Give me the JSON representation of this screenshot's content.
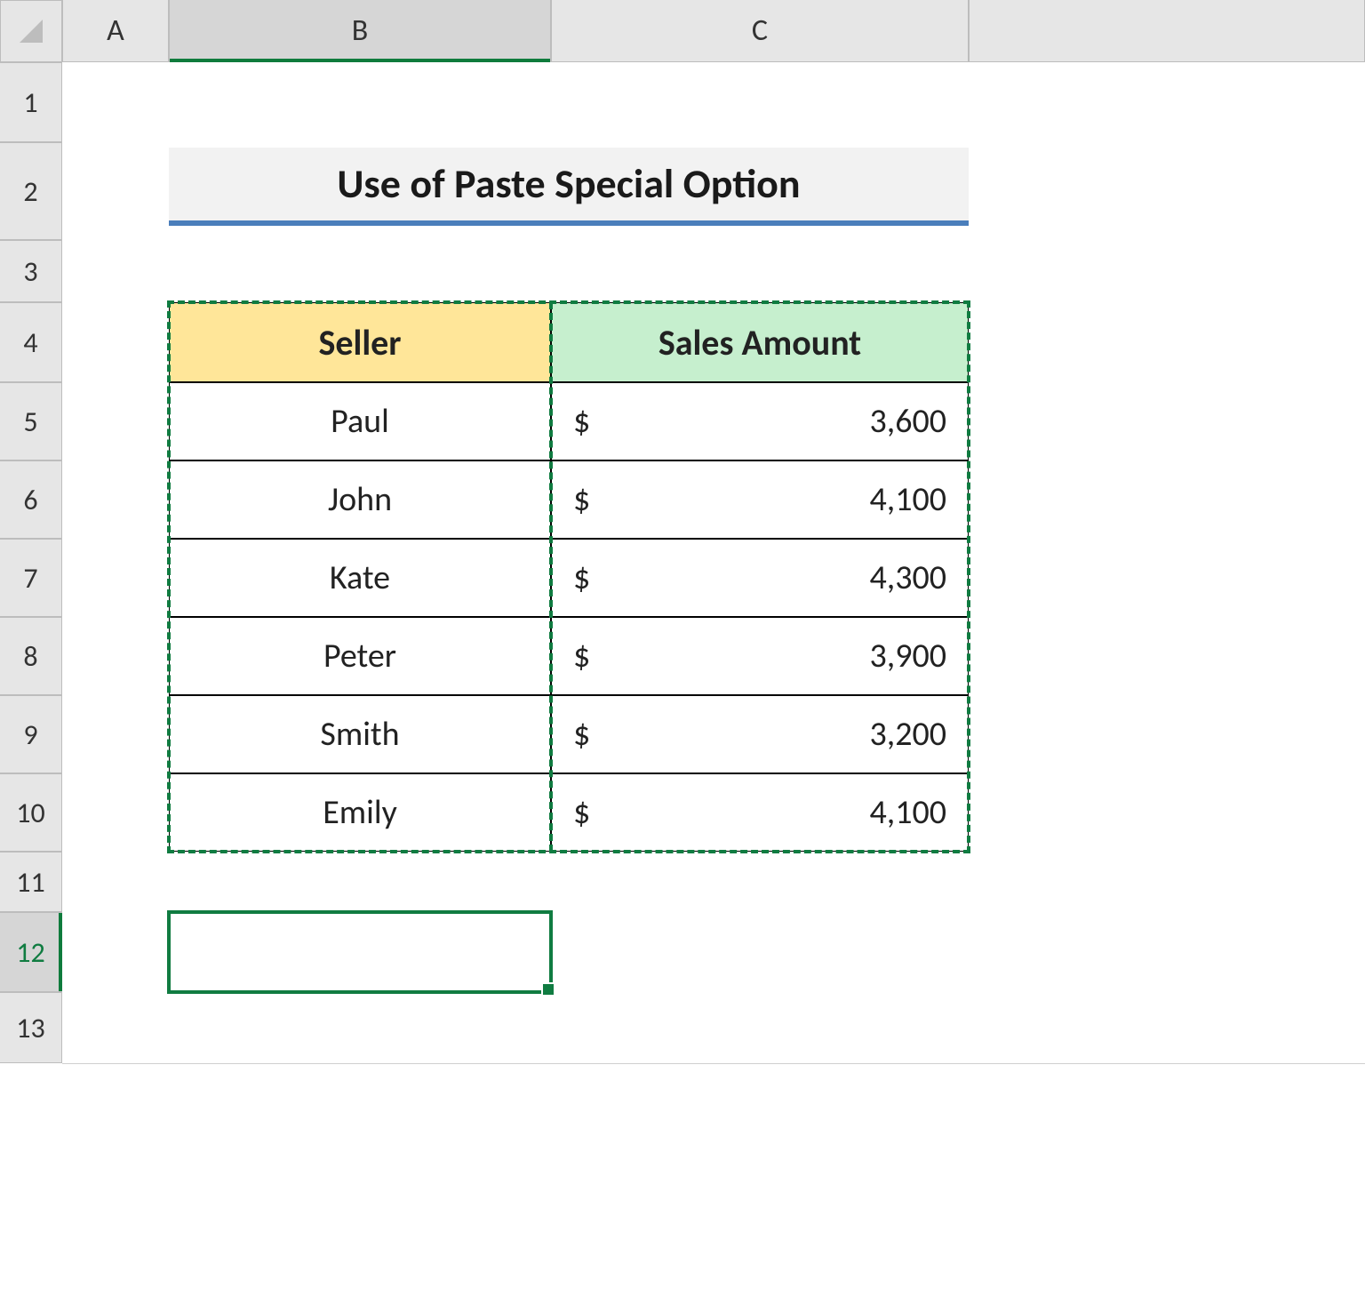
{
  "columns": [
    "A",
    "B",
    "C"
  ],
  "rows": [
    "1",
    "2",
    "3",
    "4",
    "5",
    "6",
    "7",
    "8",
    "9",
    "10",
    "11",
    "12",
    "13"
  ],
  "selected_column": "B",
  "selected_row": "12",
  "title": "Use of Paste Special Option",
  "table": {
    "headers": {
      "seller": "Seller",
      "amount": "Sales Amount"
    },
    "rows": [
      {
        "seller": "Paul",
        "currency": "$",
        "amount": "3,600"
      },
      {
        "seller": "John",
        "currency": "$",
        "amount": "4,100"
      },
      {
        "seller": "Kate",
        "currency": "$",
        "amount": "4,300"
      },
      {
        "seller": "Peter",
        "currency": "$",
        "amount": "3,900"
      },
      {
        "seller": "Smith",
        "currency": "$",
        "amount": "3,200"
      },
      {
        "seller": "Emily",
        "currency": "$",
        "amount": "4,100"
      }
    ]
  },
  "chart_data": {
    "type": "table",
    "title": "Use of Paste Special Option",
    "columns": [
      "Seller",
      "Sales Amount"
    ],
    "rows": [
      [
        "Paul",
        3600
      ],
      [
        "John",
        4100
      ],
      [
        "Kate",
        4300
      ],
      [
        "Peter",
        3900
      ],
      [
        "Smith",
        3200
      ],
      [
        "Emily",
        4100
      ]
    ]
  }
}
